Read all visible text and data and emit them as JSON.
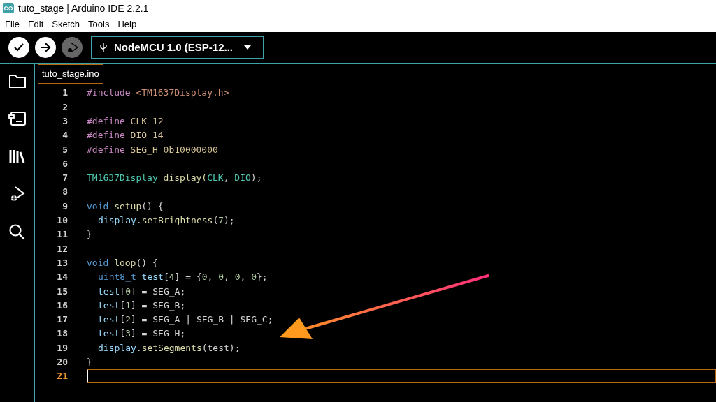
{
  "window": {
    "title": "tuto_stage | Arduino IDE 2.2.1"
  },
  "menu": [
    "File",
    "Edit",
    "Sketch",
    "Tools",
    "Help"
  ],
  "toolbar": {
    "board": "NodeMCU 1.0 (ESP-12...",
    "debug_disabled": true
  },
  "sidebar": {
    "items": [
      {
        "kind": "folder"
      },
      {
        "kind": "board"
      },
      {
        "kind": "library"
      },
      {
        "kind": "debug"
      },
      {
        "kind": "search"
      }
    ]
  },
  "tabs": [
    {
      "label": "tuto_stage.ino",
      "selected": true
    }
  ],
  "editor": {
    "lines": [
      {
        "number": "1",
        "current": false,
        "indented": false,
        "tokens": [
          {
            "kind": "directive",
            "text": "#include"
          },
          {
            "kind": "string",
            "text": " <TM1637Display.h>"
          }
        ]
      },
      {
        "number": "2",
        "current": false,
        "indented": false
      },
      {
        "number": "3",
        "current": false,
        "indented": false,
        "tokens": [
          {
            "kind": "directive",
            "text": "#define"
          },
          {
            "kind": "macro",
            "text": " CLK 12"
          }
        ]
      },
      {
        "number": "4",
        "current": false,
        "indented": false,
        "tokens": [
          {
            "kind": "directive",
            "text": "#define"
          },
          {
            "kind": "macro",
            "text": " DIO 14"
          }
        ]
      },
      {
        "number": "5",
        "current": false,
        "indented": false,
        "tokens": [
          {
            "kind": "directive",
            "text": "#define"
          },
          {
            "kind": "macro",
            "text": " SEG_H 0b10000000"
          }
        ]
      },
      {
        "number": "6",
        "current": false,
        "indented": false
      },
      {
        "number": "7",
        "current": false,
        "indented": false,
        "tokens": [
          {
            "kind": "type",
            "text": "TM1637Display"
          },
          {
            "kind": "function",
            "text": " display("
          },
          {
            "kind": "type",
            "text": "CLK"
          },
          {
            "kind": "plain",
            "text": ", "
          },
          {
            "kind": "type",
            "text": "DIO"
          },
          {
            "kind": "plain",
            "text": ");"
          }
        ]
      },
      {
        "number": "8",
        "current": false,
        "indented": false
      },
      {
        "number": "9",
        "current": false,
        "indented": false,
        "tokens": [
          {
            "kind": "keyword",
            "text": "void"
          },
          {
            "kind": "function",
            "text": " setup"
          },
          {
            "kind": "plain",
            "text": "() {"
          }
        ]
      },
      {
        "number": "10",
        "current": false,
        "indented": true,
        "tokens": [
          {
            "kind": "variable",
            "text": "display"
          },
          {
            "kind": "plain",
            "text": "."
          },
          {
            "kind": "function",
            "text": "setBrightness"
          },
          {
            "kind": "plain",
            "text": "("
          },
          {
            "kind": "number",
            "text": "7"
          },
          {
            "kind": "plain",
            "text": ");"
          }
        ]
      },
      {
        "number": "11",
        "current": false,
        "indented": false,
        "tokens": [
          {
            "kind": "plain",
            "text": "}"
          }
        ]
      },
      {
        "number": "12",
        "current": false,
        "indented": false
      },
      {
        "number": "13",
        "current": false,
        "indented": false,
        "tokens": [
          {
            "kind": "keyword",
            "text": "void"
          },
          {
            "kind": "function",
            "text": " loop"
          },
          {
            "kind": "plain",
            "text": "() {"
          }
        ]
      },
      {
        "number": "14",
        "current": false,
        "indented": true,
        "tokens": [
          {
            "kind": "keyword",
            "text": "uint8_t"
          },
          {
            "kind": "variable",
            "text": " test"
          },
          {
            "kind": "plain",
            "text": "["
          },
          {
            "kind": "number",
            "text": "4"
          },
          {
            "kind": "plain",
            "text": "] = {"
          },
          {
            "kind": "number",
            "text": "0"
          },
          {
            "kind": "plain",
            "text": ", "
          },
          {
            "kind": "number",
            "text": "0"
          },
          {
            "kind": "plain",
            "text": ", "
          },
          {
            "kind": "number",
            "text": "0"
          },
          {
            "kind": "plain",
            "text": ", "
          },
          {
            "kind": "number",
            "text": "0"
          },
          {
            "kind": "plain",
            "text": "};"
          }
        ]
      },
      {
        "number": "15",
        "current": false,
        "indented": true,
        "tokens": [
          {
            "kind": "variable",
            "text": "test"
          },
          {
            "kind": "plain",
            "text": "["
          },
          {
            "kind": "number",
            "text": "0"
          },
          {
            "kind": "plain",
            "text": "] = SEG_A;"
          }
        ]
      },
      {
        "number": "16",
        "current": false,
        "indented": true,
        "tokens": [
          {
            "kind": "variable",
            "text": "test"
          },
          {
            "kind": "plain",
            "text": "["
          },
          {
            "kind": "number",
            "text": "1"
          },
          {
            "kind": "plain",
            "text": "] = SEG_B;"
          }
        ]
      },
      {
        "number": "17",
        "current": false,
        "indented": true,
        "tokens": [
          {
            "kind": "variable",
            "text": "test"
          },
          {
            "kind": "plain",
            "text": "["
          },
          {
            "kind": "number",
            "text": "2"
          },
          {
            "kind": "plain",
            "text": "] = SEG_A | SEG_B | SEG_C;"
          }
        ]
      },
      {
        "number": "18",
        "current": false,
        "indented": true,
        "tokens": [
          {
            "kind": "variable",
            "text": "test"
          },
          {
            "kind": "plain",
            "text": "["
          },
          {
            "kind": "number",
            "text": "3"
          },
          {
            "kind": "plain",
            "text": "] = SEG_H;"
          }
        ]
      },
      {
        "number": "19",
        "current": false,
        "indented": true,
        "tokens": [
          {
            "kind": "variable",
            "text": "display"
          },
          {
            "kind": "plain",
            "text": "."
          },
          {
            "kind": "function",
            "text": "setSegments"
          },
          {
            "kind": "plain",
            "text": "(test);"
          }
        ]
      },
      {
        "number": "20",
        "current": false,
        "indented": false,
        "tokens": [
          {
            "kind": "plain",
            "text": "}"
          }
        ]
      },
      {
        "number": "21",
        "current": true,
        "indented": false
      }
    ]
  }
}
